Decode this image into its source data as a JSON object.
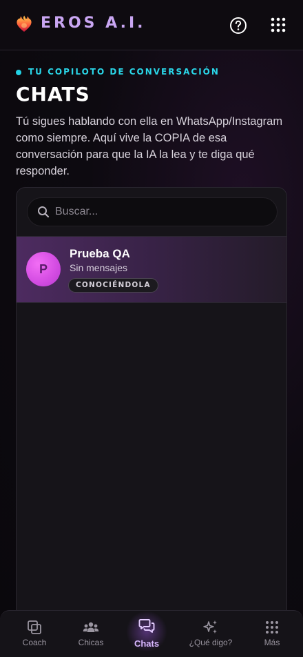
{
  "header": {
    "brand": "EROS A.I.",
    "logo_icon": "flaming-heart-icon",
    "help_icon": "help-circle-icon",
    "apps_icon": "grid-dots-icon"
  },
  "intro": {
    "eyebrow": "TU COPILOTO DE CONVERSACIÓN",
    "title": "CHATS",
    "description": "Tú sigues hablando con ella en WhatsApp/Instagram como siempre. Aquí vive la COPIA de esa conversación para que la IA la lea y te diga qué responder."
  },
  "search": {
    "placeholder": "Buscar...",
    "value": ""
  },
  "chats": [
    {
      "avatar_letter": "P",
      "name": "Prueba QA",
      "subtitle": "Sin mensajes",
      "badge": "CONOCIÉNDOLA"
    }
  ],
  "bottom_nav": [
    {
      "label": "Coach",
      "icon": "copy-icon",
      "active": false
    },
    {
      "label": "Chicas",
      "icon": "group-icon",
      "active": false
    },
    {
      "label": "Chats",
      "icon": "chat-bubbles-icon",
      "active": true
    },
    {
      "label": "¿Qué digo?",
      "icon": "sparkles-icon",
      "active": false
    },
    {
      "label": "Más",
      "icon": "grid-dots-icon",
      "active": false
    }
  ],
  "colors": {
    "accent_purple": "#c9a6f2",
    "accent_cyan": "#22d3e6",
    "active_nav": "#d9b8ff"
  }
}
